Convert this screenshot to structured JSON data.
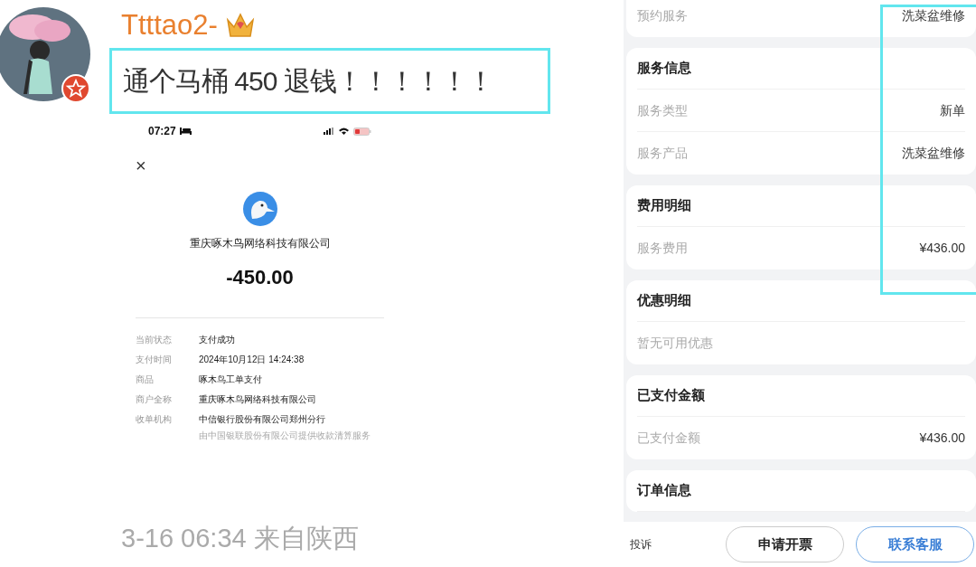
{
  "post": {
    "username": "Ttttao2-",
    "text": "通个马桶 450 退钱！！！！！！",
    "meta": "3-16 06:34 来自陕西"
  },
  "receipt": {
    "time": "07:27",
    "close": "×",
    "merchant": "重庆啄木鸟网络科技有限公司",
    "amount": "-450.00",
    "rows": [
      {
        "label": "当前状态",
        "value": "支付成功"
      },
      {
        "label": "支付时间",
        "value": "2024年10月12日 14:24:38"
      },
      {
        "label": "商品",
        "value": "啄木鸟工单支付"
      },
      {
        "label": "商户全称",
        "value": "重庆啄木鸟网络科技有限公司"
      },
      {
        "label": "收单机构",
        "value": "中信银行股份有限公司郑州分行",
        "note": "由中国银联股份有限公司提供收款清算服务"
      }
    ]
  },
  "order": {
    "cards": [
      {
        "rows": [
          {
            "label": "预约服务",
            "value": "洗菜盆维修"
          }
        ]
      },
      {
        "title": "服务信息",
        "rows": [
          {
            "label": "服务类型",
            "value": "新单"
          },
          {
            "label": "服务产品",
            "value": "洗菜盆维修"
          }
        ]
      },
      {
        "title": "费用明细",
        "rows": [
          {
            "label": "服务费用",
            "value": "¥436.00"
          }
        ]
      },
      {
        "title": "优惠明细",
        "rows": [
          {
            "label": "暂无可用优惠"
          }
        ]
      },
      {
        "title": "已支付金额",
        "rows": [
          {
            "label": "已支付金额",
            "value": "¥436.00"
          }
        ]
      },
      {
        "title": "订单信息"
      }
    ],
    "bottom_bar": {
      "complaint": "投诉",
      "buttons": [
        {
          "label": "申请开票",
          "kind": "plain"
        },
        {
          "label": "联系客服",
          "kind": "primary"
        }
      ]
    }
  }
}
